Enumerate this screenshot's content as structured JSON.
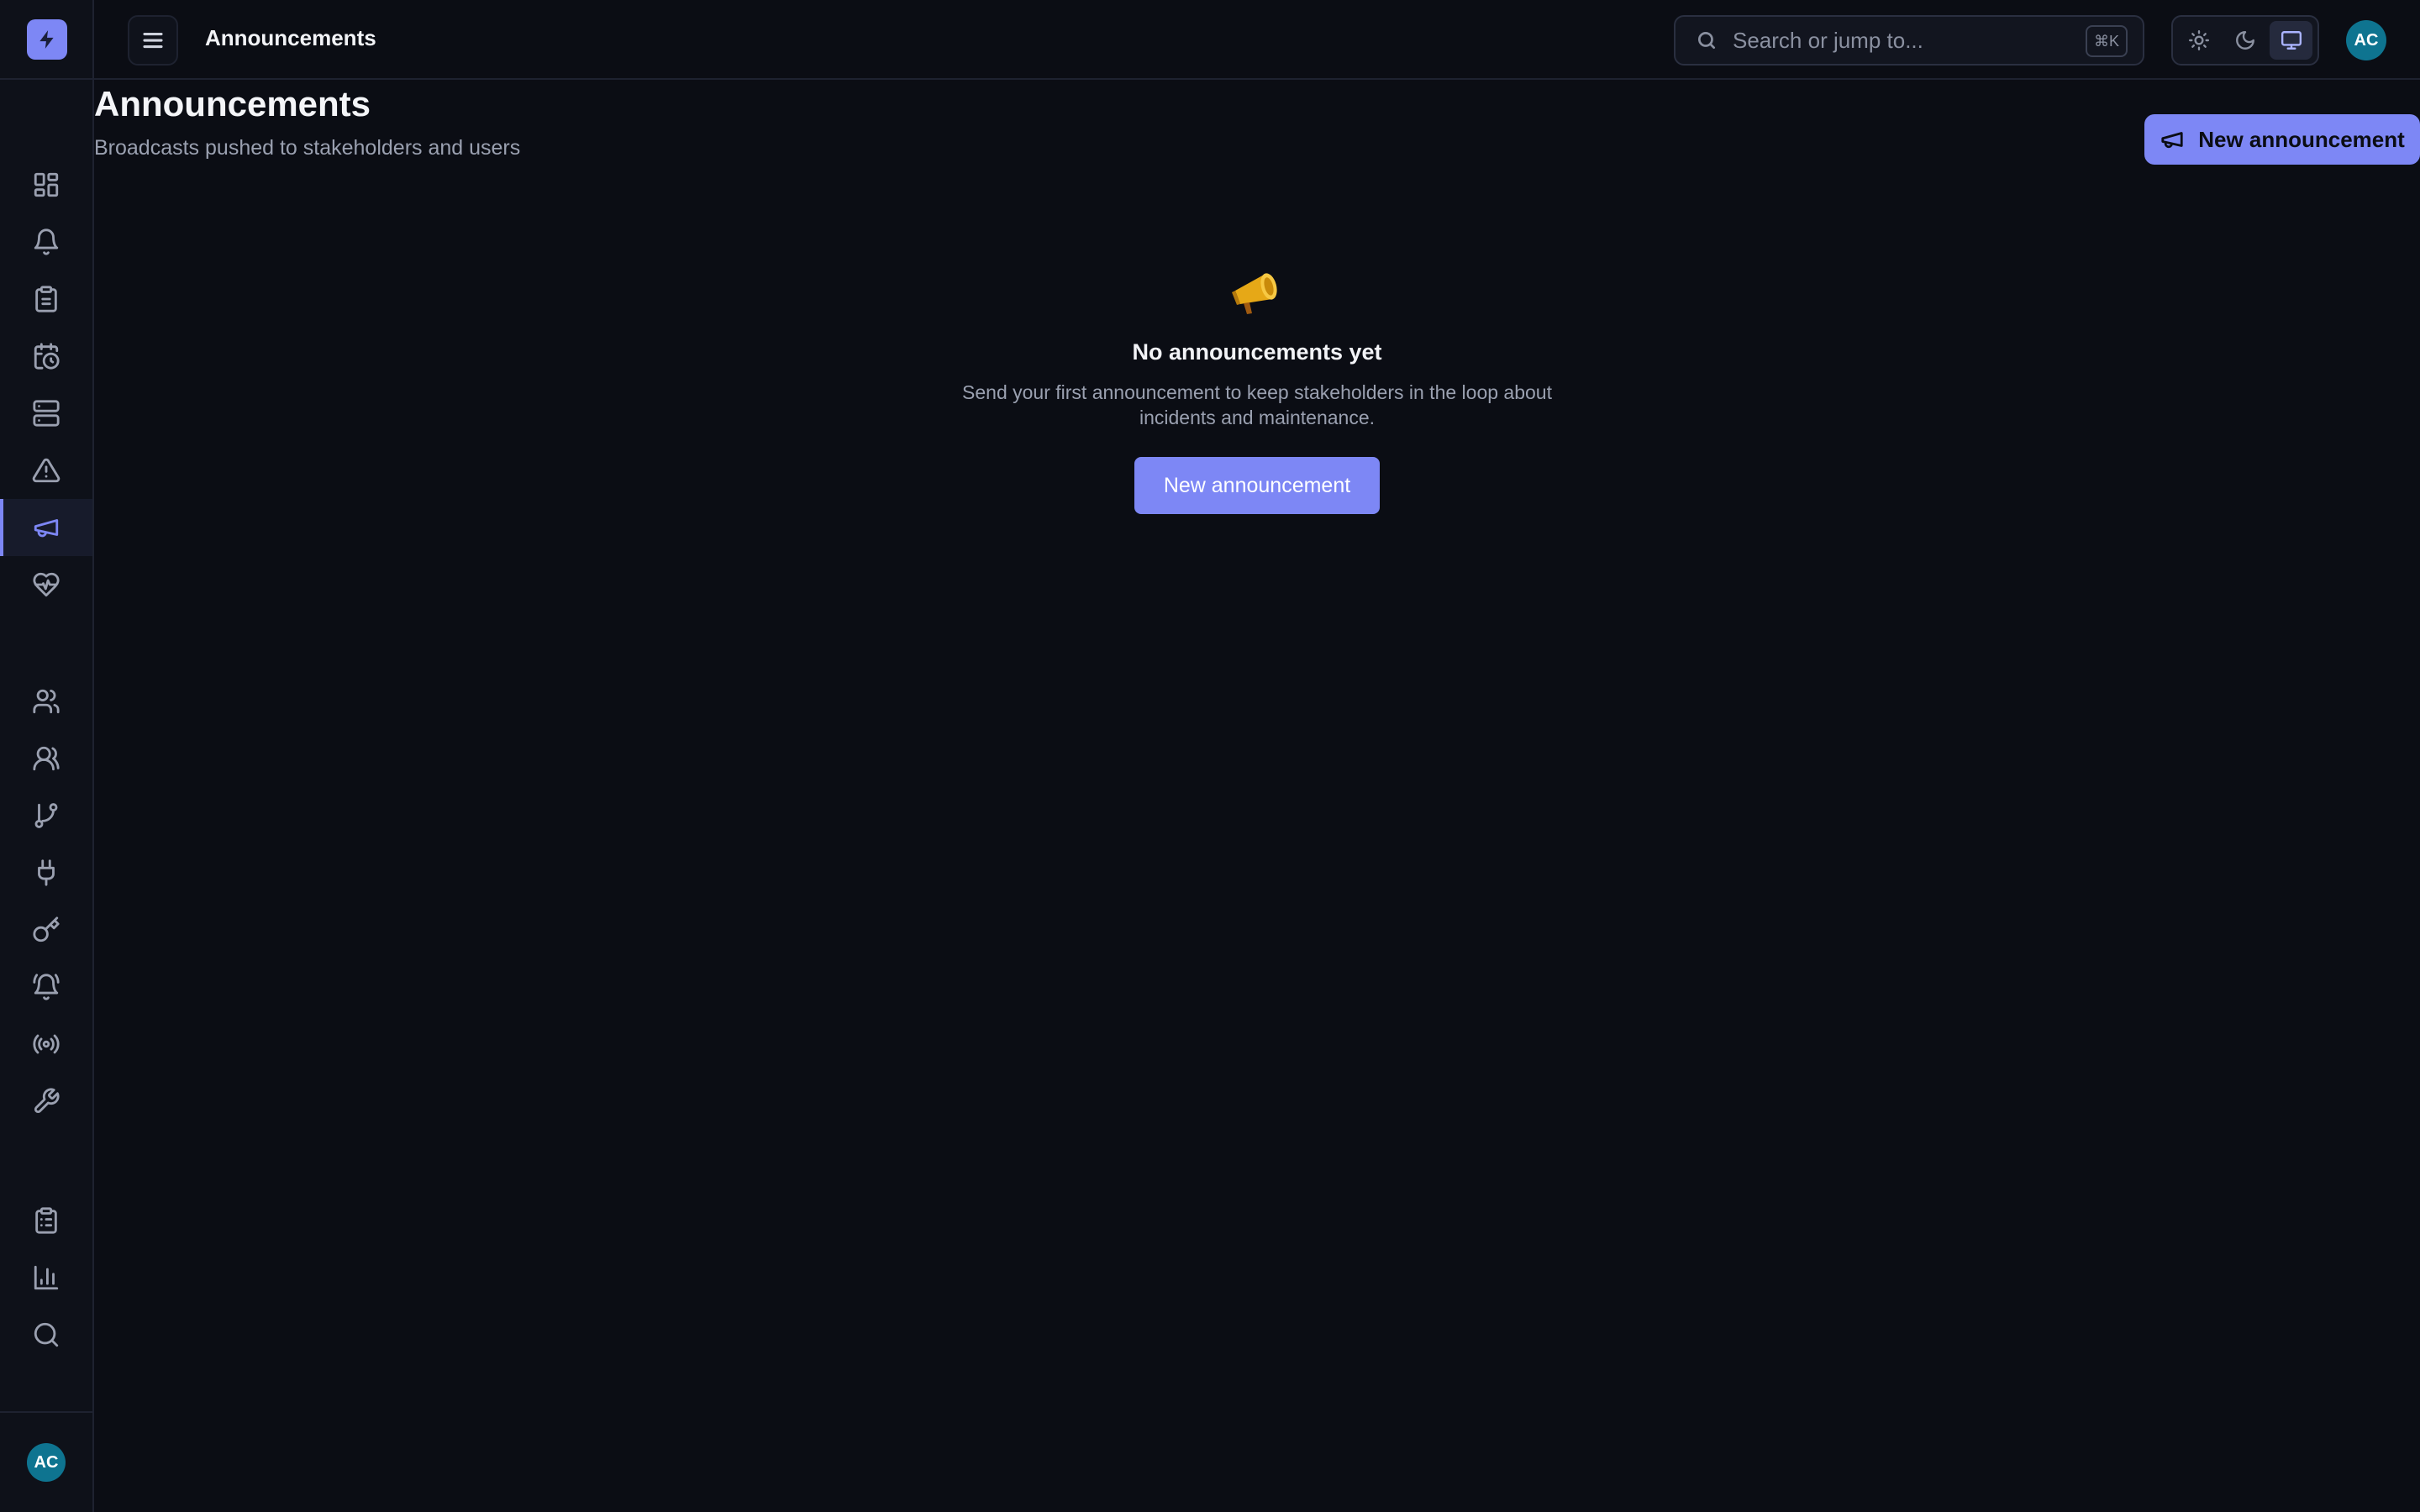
{
  "header": {
    "title": "Announcements",
    "search_placeholder": "Search or jump to...",
    "search_shortcut": "⌘K",
    "user_initials": "AC"
  },
  "page": {
    "title": "Announcements",
    "subtitle": "Broadcasts pushed to stakeholders and users",
    "new_button_label": "New announcement"
  },
  "empty_state": {
    "icon": "megaphone-emoji",
    "title": "No announcements yet",
    "description": "Send your first announcement to keep stakeholders in the loop about incidents and maintenance.",
    "button_label": "New announcement"
  },
  "sidebar": {
    "user_initials": "AC",
    "items": [
      {
        "icon": "dashboard-icon"
      },
      {
        "icon": "bell-icon"
      },
      {
        "icon": "clipboard-icon"
      },
      {
        "icon": "calendar-clock-icon"
      },
      {
        "icon": "server-icon"
      },
      {
        "icon": "alert-triangle-icon"
      },
      {
        "icon": "megaphone-icon",
        "active": true
      },
      {
        "icon": "heart-pulse-icon"
      },
      {
        "icon": "users-icon"
      },
      {
        "icon": "team-icon"
      },
      {
        "icon": "git-branch-icon"
      },
      {
        "icon": "plug-icon"
      },
      {
        "icon": "key-icon"
      },
      {
        "icon": "bell-ring-icon"
      },
      {
        "icon": "radio-icon"
      },
      {
        "icon": "wrench-icon"
      },
      {
        "icon": "clipboard-list-icon"
      },
      {
        "icon": "bar-chart-icon"
      },
      {
        "icon": "search-icon"
      }
    ]
  },
  "colors": {
    "accent": "#7d87f5",
    "background": "#0b0d14",
    "avatar": "#0e7490"
  }
}
